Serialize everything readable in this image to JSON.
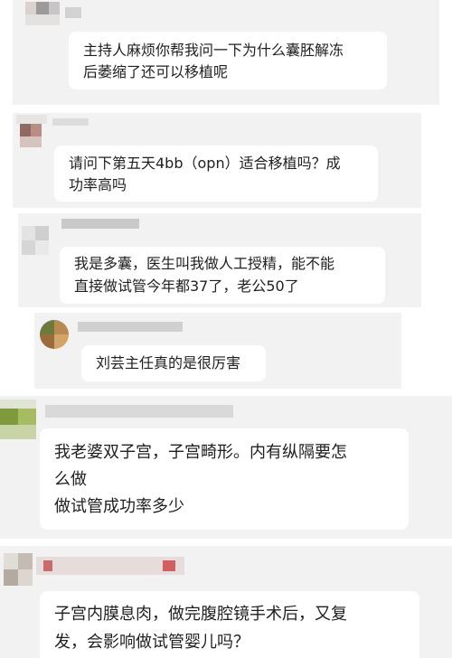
{
  "comments": [
    {
      "avatar_icon": "blurred-avatar",
      "lines": [
        "主持人麻烦你帮我问一下为什么囊胚解冻",
        "后萎缩了还可以移植呢"
      ]
    },
    {
      "avatar_icon": "blurred-avatar",
      "lines": [
        "请问下第五天4bb（opn）适合移植吗？成",
        "功率高吗"
      ]
    },
    {
      "avatar_icon": "blurred-avatar",
      "lines": [
        "我是多囊，医生叫我做人工授精，能不能",
        "直接做试管今年都37了，老公50了"
      ]
    },
    {
      "avatar_icon": "blurred-avatar",
      "lines": [
        "刘芸主任真的是很厉害"
      ]
    },
    {
      "avatar_icon": "blurred-avatar",
      "lines": [
        "我老婆双子宫，子宫畸形。内有纵隔要怎",
        "么做",
        "做试管成功率多少"
      ]
    },
    {
      "avatar_icon": "blurred-avatar",
      "lines": [
        "子宫内膜息肉，做完腹腔镜手术后，又复",
        "发，会影响做试管婴儿吗？"
      ]
    }
  ]
}
